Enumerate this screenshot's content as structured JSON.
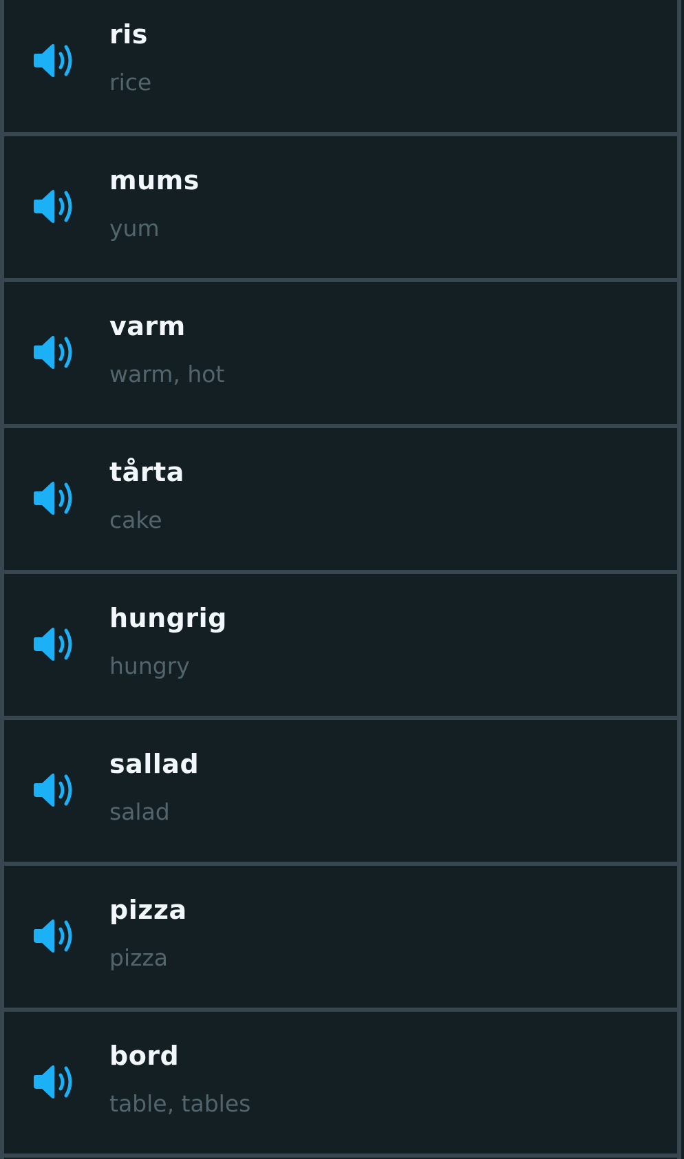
{
  "colors": {
    "accent": "#1cb0f6",
    "background": "#141f24",
    "border": "#37464f",
    "word": "#f1f7fb",
    "translation": "#52656d"
  },
  "items": [
    {
      "word": "ris",
      "translation": "rice",
      "icon": "speaker-icon"
    },
    {
      "word": "mums",
      "translation": "yum",
      "icon": "speaker-icon"
    },
    {
      "word": "varm",
      "translation": "warm, hot",
      "icon": "speaker-icon"
    },
    {
      "word": "tårta",
      "translation": "cake",
      "icon": "speaker-icon"
    },
    {
      "word": "hungrig",
      "translation": "hungry",
      "icon": "speaker-icon"
    },
    {
      "word": "sallad",
      "translation": "salad",
      "icon": "speaker-icon"
    },
    {
      "word": "pizza",
      "translation": "pizza",
      "icon": "speaker-icon"
    },
    {
      "word": "bord",
      "translation": "table, tables",
      "icon": "speaker-icon"
    }
  ]
}
